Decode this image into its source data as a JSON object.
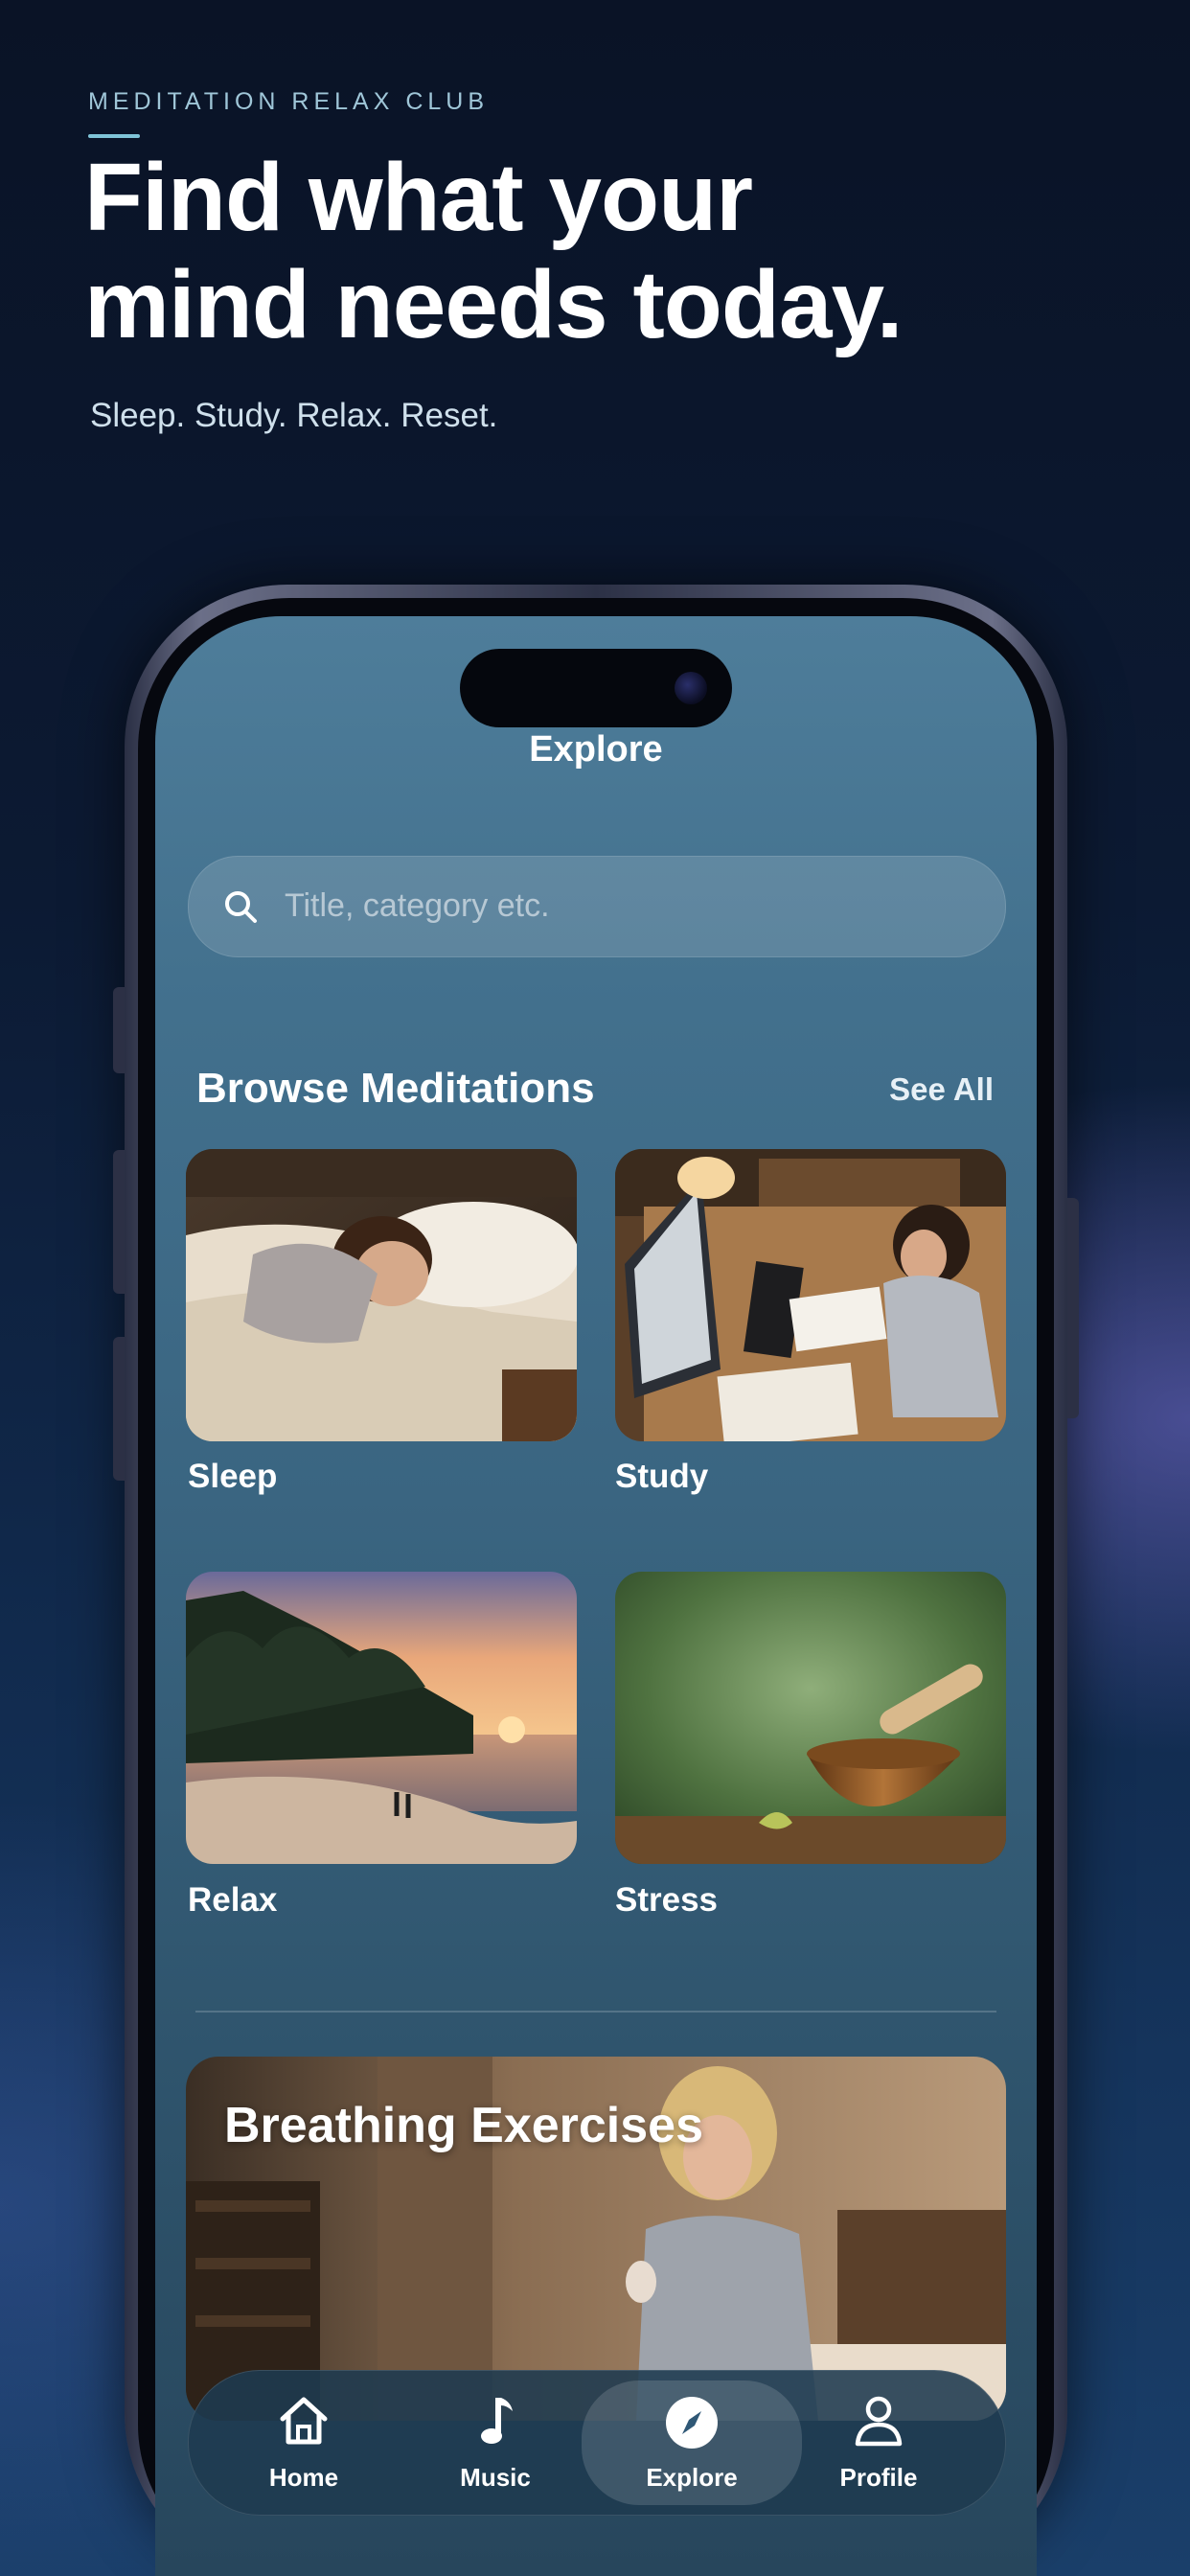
{
  "promo": {
    "brand": "MEDITATION RELAX CLUB",
    "headline_line1": "Find what your",
    "headline_line2": "mind needs today.",
    "tagline": "Sleep. Study. Relax. Reset."
  },
  "screen": {
    "title": "Explore",
    "search": {
      "placeholder": "Title, category etc.",
      "icon": "search-icon"
    },
    "browse": {
      "title": "Browse Meditations",
      "see_all": "See All",
      "categories": [
        {
          "label": "Sleep",
          "image": "woman-sleeping-in-bed"
        },
        {
          "label": "Study",
          "image": "woman-studying-at-desk"
        },
        {
          "label": "Relax",
          "image": "tropical-beach-sunset"
        },
        {
          "label": "Stress",
          "image": "singing-bowl"
        }
      ]
    },
    "featured": {
      "title": "Breathing Exercises",
      "image": "woman-breathing-in-bedroom"
    }
  },
  "tabbar": {
    "active": "Explore",
    "tabs": [
      {
        "label": "Home",
        "icon": "home-icon"
      },
      {
        "label": "Music",
        "icon": "music-note-icon"
      },
      {
        "label": "Explore",
        "icon": "compass-icon"
      },
      {
        "label": "Profile",
        "icon": "profile-icon"
      }
    ]
  },
  "colors": {
    "background": "#0c1a33",
    "accent": "#7fc4d8",
    "screen_top": "#4e7d9a",
    "screen_bottom": "#27465c"
  }
}
